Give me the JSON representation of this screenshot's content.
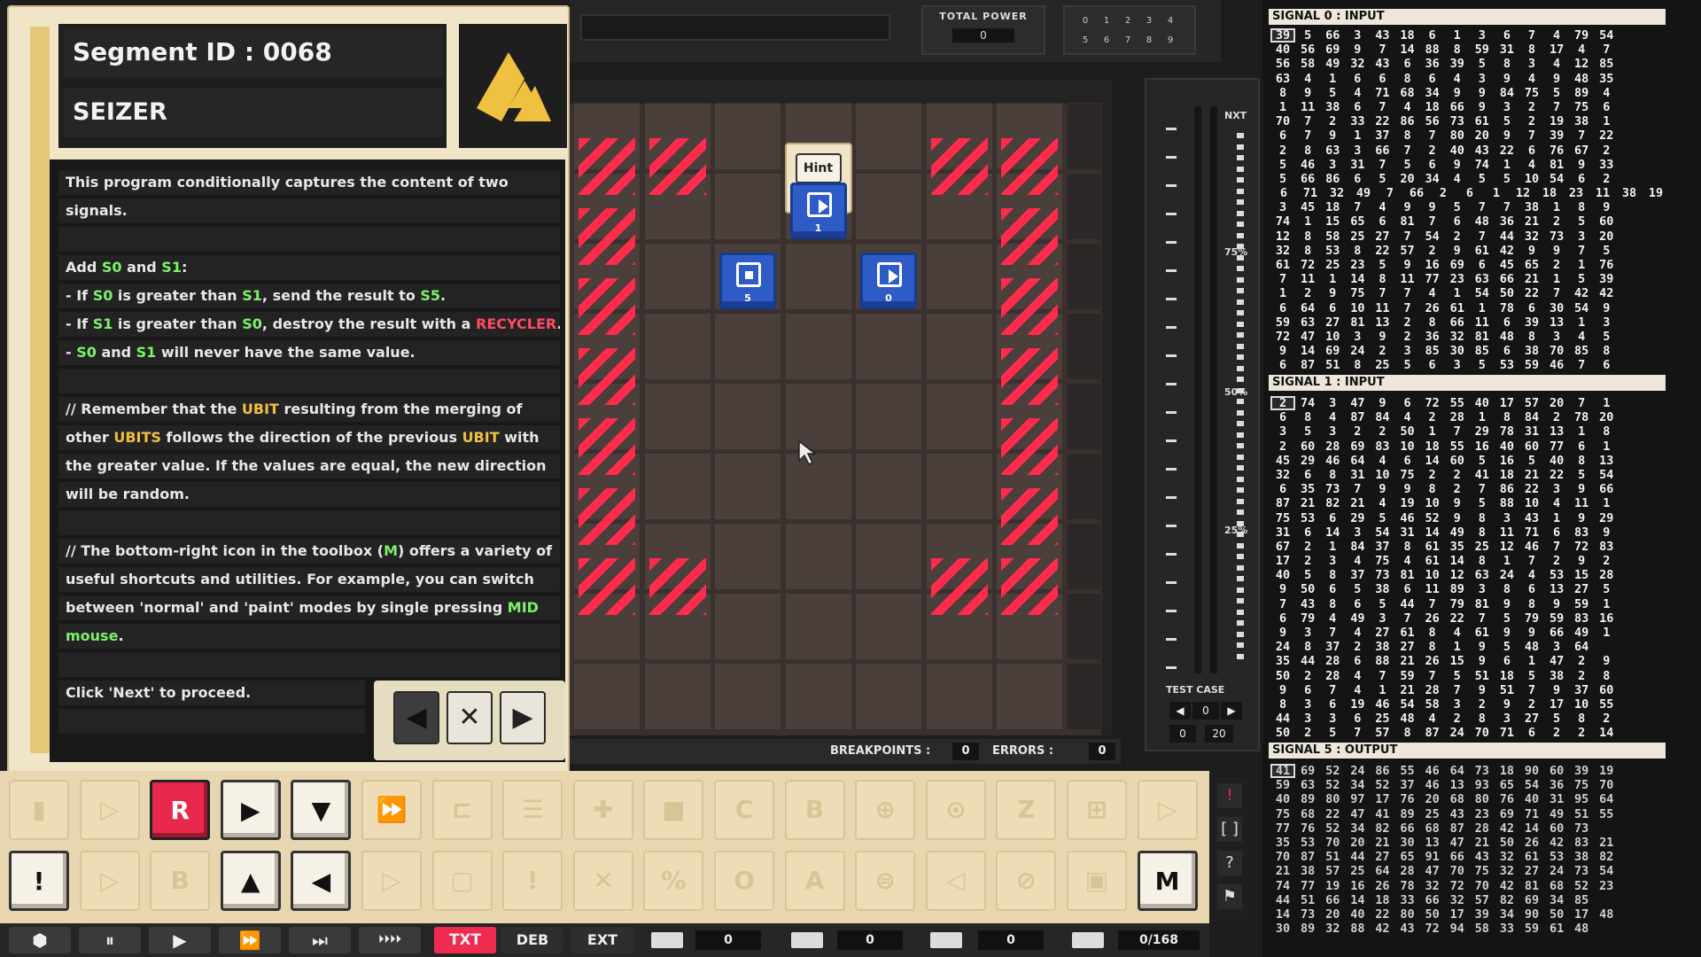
{
  "briefing": {
    "segment_id": "Segment ID : 0068",
    "program_name": "SEIZER",
    "lines": [
      {
        "parts": [
          {
            "t": "This program conditionally captures the content of two",
            "c": ""
          }
        ]
      },
      {
        "parts": [
          {
            "t": "signals.",
            "c": ""
          }
        ]
      },
      {
        "parts": [
          {
            "t": "",
            "c": ""
          }
        ]
      },
      {
        "parts": [
          {
            "t": "Add ",
            "c": ""
          },
          {
            "t": "S0",
            "c": "sig"
          },
          {
            "t": " and ",
            "c": ""
          },
          {
            "t": "S1",
            "c": "sig"
          },
          {
            "t": ":",
            "c": ""
          }
        ]
      },
      {
        "parts": [
          {
            "t": "- If ",
            "c": ""
          },
          {
            "t": "S0",
            "c": "sig"
          },
          {
            "t": " is greater than ",
            "c": ""
          },
          {
            "t": "S1",
            "c": "sig"
          },
          {
            "t": ", send the result to ",
            "c": ""
          },
          {
            "t": "S5",
            "c": "sig"
          },
          {
            "t": ".",
            "c": ""
          }
        ]
      },
      {
        "parts": [
          {
            "t": "- If ",
            "c": ""
          },
          {
            "t": "S1",
            "c": "sig"
          },
          {
            "t": " is greater than ",
            "c": ""
          },
          {
            "t": "S0",
            "c": "sig"
          },
          {
            "t": ", destroy the result with a ",
            "c": ""
          },
          {
            "t": "RECYCLER",
            "c": "rec"
          },
          {
            "t": ".",
            "c": ""
          }
        ]
      },
      {
        "parts": [
          {
            "t": "- ",
            "c": ""
          },
          {
            "t": "S0",
            "c": "sig"
          },
          {
            "t": " and ",
            "c": ""
          },
          {
            "t": "S1",
            "c": "sig"
          },
          {
            "t": " will never have the same value.",
            "c": ""
          }
        ]
      },
      {
        "parts": [
          {
            "t": "",
            "c": ""
          }
        ]
      },
      {
        "parts": [
          {
            "t": "// Remember that the ",
            "c": ""
          },
          {
            "t": "UBIT",
            "c": "ubit"
          },
          {
            "t": " resulting from the merging of",
            "c": ""
          }
        ]
      },
      {
        "parts": [
          {
            "t": "other ",
            "c": ""
          },
          {
            "t": "UBITS",
            "c": "ubit"
          },
          {
            "t": " follows the direction of the previous ",
            "c": ""
          },
          {
            "t": "UBIT",
            "c": "ubit"
          },
          {
            "t": " with",
            "c": ""
          }
        ]
      },
      {
        "parts": [
          {
            "t": "the greater value. If the values are equal, the new direction",
            "c": ""
          }
        ]
      },
      {
        "parts": [
          {
            "t": "will be random.",
            "c": ""
          }
        ]
      },
      {
        "parts": [
          {
            "t": "",
            "c": ""
          }
        ]
      },
      {
        "parts": [
          {
            "t": "// The bottom-right icon in the toolbox (",
            "c": ""
          },
          {
            "t": "M",
            "c": "sig"
          },
          {
            "t": ") offers a variety of",
            "c": ""
          }
        ]
      },
      {
        "parts": [
          {
            "t": "useful shortcuts and utilities. For example, you can switch",
            "c": ""
          }
        ]
      },
      {
        "parts": [
          {
            "t": "between 'normal' and 'paint' modes by single pressing ",
            "c": ""
          },
          {
            "t": "MID",
            "c": "sig"
          }
        ]
      },
      {
        "parts": [
          {
            "t": "mouse",
            "c": "sig"
          },
          {
            "t": ".",
            "c": ""
          }
        ]
      },
      {
        "parts": [
          {
            "t": "",
            "c": ""
          }
        ]
      },
      {
        "parts": [
          {
            "t": "Click 'Next' to proceed.",
            "c": ""
          }
        ]
      },
      {
        "parts": [
          {
            "t": "",
            "c": ""
          }
        ]
      }
    ],
    "nav": {
      "prev": "◀",
      "close": "✕",
      "next": "▶"
    }
  },
  "topbar": {
    "total_power_label": "TOTAL POWER",
    "total_power_value": "0",
    "dial_numbers": [
      "0",
      "1",
      "2",
      "3",
      "4",
      "5",
      "6",
      "7",
      "8",
      "9"
    ]
  },
  "board": {
    "hint_label": "Hint",
    "instructions": [
      {
        "label": "1",
        "kind": "play",
        "col": 3,
        "row": 1
      },
      {
        "label": "5",
        "kind": "stop",
        "col": 2,
        "row": 2
      },
      {
        "label": "0",
        "kind": "play",
        "col": 4,
        "row": 2
      }
    ]
  },
  "status": {
    "breakpoints_label": "BREAKPOINTS :",
    "breakpoints_value": "0",
    "errors_label": "ERRORS :",
    "errors_value": "0"
  },
  "gauge": {
    "nxt": "NXT",
    "p75": "75%",
    "p50": "50%",
    "p25": "25%",
    "test_case_label": "TEST CASE",
    "test_case_value": "0",
    "range_min": "0",
    "range_max": "20",
    "prev": "◀",
    "next": "▶"
  },
  "signals": {
    "s0_title": "SIGNAL 0 : INPUT",
    "s0": [
      [
        39,
        5,
        66,
        3,
        43,
        18,
        6,
        1,
        3,
        6,
        7,
        4,
        79,
        54
      ],
      [
        40,
        56,
        69,
        9,
        7,
        14,
        88,
        8,
        59,
        31,
        8,
        17,
        4,
        7
      ],
      [
        56,
        58,
        49,
        32,
        43,
        6,
        36,
        39,
        5,
        8,
        3,
        4,
        12,
        85
      ],
      [
        63,
        4,
        1,
        6,
        6,
        8,
        6,
        4,
        3,
        9,
        4,
        9,
        48,
        35
      ],
      [
        8,
        9,
        5,
        4,
        71,
        68,
        34,
        9,
        9,
        84,
        75,
        5,
        89,
        4
      ],
      [
        1,
        11,
        38,
        6,
        7,
        4,
        18,
        66,
        9,
        3,
        2,
        7,
        75,
        6
      ],
      [
        70,
        7,
        2,
        33,
        22,
        86,
        56,
        73,
        61,
        5,
        2,
        19,
        38,
        1
      ],
      [
        6,
        7,
        9,
        1,
        37,
        8,
        7,
        80,
        20,
        9,
        7,
        39,
        7,
        22
      ],
      [
        2,
        8,
        63,
        3,
        66,
        7,
        2,
        40,
        43,
        22,
        6,
        76,
        67,
        2
      ],
      [
        5,
        46,
        3,
        31,
        7,
        5,
        6,
        9,
        74,
        1,
        4,
        81,
        9,
        33
      ],
      [
        5,
        66,
        86,
        6,
        5,
        20,
        34,
        4,
        5,
        5,
        10,
        54,
        6,
        2
      ],
      [
        6,
        71,
        32,
        49,
        7,
        66,
        2,
        6,
        1,
        12,
        18,
        23,
        11,
        38,
        19
      ],
      [
        3,
        45,
        18,
        7,
        4,
        9,
        9,
        5,
        7,
        7,
        38,
        1,
        8,
        9
      ],
      [
        74,
        1,
        15,
        65,
        6,
        81,
        7,
        6,
        48,
        36,
        21,
        2,
        5,
        60
      ],
      [
        12,
        8,
        58,
        25,
        27,
        7,
        54,
        2,
        7,
        44,
        32,
        73,
        3,
        20
      ],
      [
        32,
        8,
        53,
        8,
        22,
        57,
        2,
        9,
        61,
        42,
        9,
        9,
        7,
        5
      ],
      [
        61,
        72,
        25,
        23,
        5,
        9,
        16,
        69,
        6,
        45,
        65,
        2,
        1,
        76
      ],
      [
        7,
        11,
        1,
        14,
        8,
        11,
        77,
        23,
        63,
        66,
        21,
        1,
        5,
        39
      ],
      [
        1,
        2,
        9,
        75,
        7,
        7,
        4,
        1,
        54,
        50,
        22,
        7,
        42,
        42
      ],
      [
        6,
        64,
        6,
        10,
        11,
        7,
        26,
        61,
        1,
        78,
        6,
        30,
        54,
        9
      ],
      [
        59,
        63,
        27,
        81,
        13,
        2,
        8,
        66,
        11,
        6,
        39,
        13,
        1,
        3
      ],
      [
        72,
        47,
        10,
        3,
        9,
        2,
        36,
        32,
        81,
        48,
        8,
        3,
        4,
        5
      ],
      [
        9,
        14,
        69,
        24,
        2,
        3,
        85,
        30,
        85,
        6,
        38,
        70,
        85,
        8
      ],
      [
        6,
        87,
        51,
        8,
        25,
        5,
        6,
        3,
        5,
        53,
        59,
        46,
        7,
        6
      ]
    ],
    "s1_title": "SIGNAL 1 : INPUT",
    "s1": [
      [
        2,
        74,
        3,
        47,
        9,
        6,
        72,
        55,
        40,
        17,
        57,
        20,
        7,
        1
      ],
      [
        6,
        8,
        4,
        87,
        84,
        4,
        2,
        28,
        1,
        8,
        84,
        2,
        78,
        20
      ],
      [
        3,
        5,
        3,
        2,
        2,
        50,
        1,
        7,
        29,
        78,
        31,
        13,
        1,
        8
      ],
      [
        2,
        60,
        28,
        69,
        83,
        10,
        18,
        55,
        16,
        40,
        60,
        77,
        6,
        1
      ],
      [
        45,
        29,
        46,
        64,
        4,
        6,
        14,
        60,
        5,
        16,
        5,
        40,
        8,
        13
      ],
      [
        32,
        6,
        8,
        31,
        10,
        75,
        2,
        2,
        41,
        18,
        21,
        22,
        5,
        54
      ],
      [
        6,
        35,
        73,
        7,
        9,
        9,
        8,
        2,
        7,
        86,
        22,
        3,
        9,
        66
      ],
      [
        87,
        21,
        82,
        21,
        4,
        19,
        10,
        9,
        5,
        88,
        10,
        4,
        11,
        1
      ],
      [
        75,
        53,
        6,
        29,
        5,
        46,
        52,
        9,
        8,
        3,
        43,
        1,
        9,
        29
      ],
      [
        31,
        6,
        14,
        3,
        54,
        31,
        14,
        49,
        8,
        11,
        71,
        6,
        83,
        9
      ],
      [
        67,
        2,
        1,
        84,
        37,
        8,
        61,
        35,
        25,
        12,
        46,
        7,
        72,
        83
      ],
      [
        17,
        2,
        3,
        4,
        75,
        4,
        61,
        14,
        8,
        1,
        7,
        2,
        9,
        2
      ],
      [
        40,
        5,
        8,
        37,
        73,
        81,
        10,
        12,
        63,
        24,
        4,
        53,
        15,
        28
      ],
      [
        9,
        50,
        6,
        5,
        38,
        6,
        11,
        89,
        3,
        8,
        6,
        13,
        27,
        5
      ],
      [
        7,
        43,
        8,
        6,
        5,
        44,
        7,
        79,
        81,
        9,
        8,
        9,
        59,
        1
      ],
      [
        6,
        79,
        4,
        49,
        3,
        7,
        26,
        22,
        7,
        5,
        79,
        59,
        83,
        16
      ],
      [
        9,
        3,
        7,
        4,
        27,
        61,
        8,
        4,
        61,
        9,
        9,
        66,
        49,
        1
      ],
      [
        24,
        8,
        37,
        2,
        38,
        27,
        8,
        1,
        9,
        5,
        48,
        3,
        64
      ],
      [
        35,
        44,
        28,
        6,
        88,
        21,
        26,
        15,
        9,
        6,
        1,
        47,
        2,
        9
      ],
      [
        50,
        2,
        28,
        4,
        7,
        59,
        7,
        5,
        51,
        18,
        5,
        38,
        2,
        8
      ],
      [
        9,
        6,
        7,
        4,
        1,
        21,
        28,
        7,
        9,
        51,
        7,
        9,
        37,
        60
      ],
      [
        8,
        3,
        6,
        19,
        46,
        54,
        58,
        3,
        2,
        9,
        2,
        17,
        10,
        55
      ],
      [
        44,
        3,
        3,
        6,
        25,
        48,
        4,
        2,
        8,
        3,
        27,
        5,
        8,
        2
      ],
      [
        50,
        2,
        5,
        7,
        57,
        8,
        87,
        24,
        70,
        71,
        6,
        2,
        2,
        14
      ]
    ],
    "s5_title": "SIGNAL 5 : OUTPUT",
    "s5": [
      [
        41,
        69,
        52,
        24,
        86,
        55,
        46,
        64,
        73,
        18,
        90,
        60,
        39,
        19
      ],
      [
        59,
        63,
        52,
        34,
        52,
        37,
        46,
        13,
        93,
        65,
        54,
        36,
        75,
        70
      ],
      [
        40,
        89,
        80,
        97,
        17,
        76,
        20,
        68,
        80,
        76,
        40,
        31,
        95,
        64
      ],
      [
        75,
        68,
        22,
        47,
        41,
        89,
        25,
        43,
        23,
        69,
        71,
        49,
        51,
        55
      ],
      [
        77,
        76,
        52,
        34,
        82,
        66,
        68,
        87,
        28,
        42,
        14,
        60,
        73
      ],
      [
        35,
        53,
        70,
        20,
        21,
        30,
        13,
        47,
        21,
        50,
        26,
        42,
        83,
        21
      ],
      [
        70,
        87,
        51,
        44,
        27,
        65,
        91,
        66,
        43,
        32,
        61,
        53,
        38,
        82
      ],
      [
        21,
        38,
        57,
        25,
        64,
        28,
        47,
        70,
        75,
        32,
        27,
        24,
        73,
        54
      ],
      [
        74,
        77,
        19,
        16,
        26,
        78,
        32,
        72,
        70,
        42,
        81,
        68,
        52,
        23
      ],
      [
        44,
        51,
        66,
        14,
        18,
        33,
        66,
        32,
        57,
        82,
        69,
        34,
        85
      ],
      [
        14,
        73,
        20,
        40,
        22,
        80,
        50,
        17,
        39,
        34,
        90,
        50,
        17,
        48
      ],
      [
        30,
        89,
        32,
        88,
        42,
        43,
        72,
        94,
        58,
        33,
        59,
        61,
        48
      ]
    ]
  },
  "toolbox": {
    "row1": [
      {
        "g": "▮",
        "s": ""
      },
      {
        "g": "▷",
        "s": ""
      },
      {
        "g": "R",
        "s": "red"
      },
      {
        "g": "▶",
        "s": "active"
      },
      {
        "g": "▼",
        "s": "active"
      },
      {
        "g": "⏩",
        "s": ""
      },
      {
        "g": "⊏",
        "s": ""
      },
      {
        "g": "☰",
        "s": ""
      },
      {
        "g": "✚",
        "s": ""
      },
      {
        "g": "■",
        "s": ""
      },
      {
        "g": "C",
        "s": ""
      },
      {
        "g": "B",
        "s": ""
      },
      {
        "g": "⊕",
        "s": ""
      },
      {
        "g": "⊙",
        "s": ""
      },
      {
        "g": "Z",
        "s": ""
      },
      {
        "g": "⊞",
        "s": ""
      },
      {
        "g": "▷",
        "s": ""
      }
    ],
    "row2": [
      {
        "g": "!",
        "s": "active"
      },
      {
        "g": "▷",
        "s": ""
      },
      {
        "g": "B",
        "s": ""
      },
      {
        "g": "▲",
        "s": "active"
      },
      {
        "g": "◀",
        "s": "active"
      },
      {
        "g": "▷",
        "s": ""
      },
      {
        "g": "▢",
        "s": ""
      },
      {
        "g": "!",
        "s": ""
      },
      {
        "g": "✕",
        "s": ""
      },
      {
        "g": "%",
        "s": ""
      },
      {
        "g": "O",
        "s": ""
      },
      {
        "g": "A",
        "s": ""
      },
      {
        "g": "⊜",
        "s": ""
      },
      {
        "g": "◁",
        "s": ""
      },
      {
        "g": "⊘",
        "s": ""
      },
      {
        "g": "▣",
        "s": ""
      },
      {
        "g": "M",
        "s": "active"
      }
    ]
  },
  "speedbar": {
    "buttons": [
      "⬢",
      "⏸",
      "▶",
      "⏩",
      "⏭",
      "⏵⏵⏵⏵"
    ],
    "txt": "TXT",
    "deb": "DEB",
    "ext": "EXT",
    "counter1": "0",
    "counter2": "0",
    "counter3": "0",
    "counter4": "0/168"
  },
  "sidebtns": [
    "!",
    "[ ]",
    "?",
    "⚑"
  ]
}
